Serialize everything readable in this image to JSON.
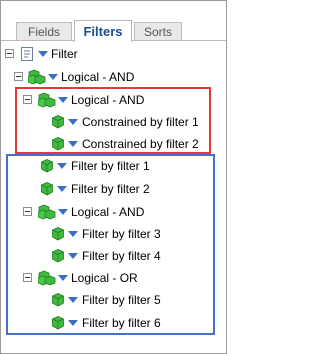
{
  "tabs": [
    {
      "label": "Fields"
    },
    {
      "label": "Filters"
    },
    {
      "label": "Sorts"
    }
  ],
  "tree": {
    "root_label": "Filter",
    "logical_and_1": "Logical - AND",
    "logical_and_2": "Logical - AND",
    "constrained_1": "Constrained by filter 1",
    "constrained_2": "Constrained by filter 2",
    "filter_1": "Filter by filter 1",
    "filter_2": "Filter by filter 2",
    "logical_and_3": "Logical - AND",
    "filter_3": "Filter by filter 3",
    "filter_4": "Filter by filter 4",
    "logical_or": "Logical - OR",
    "filter_5": "Filter by filter 5",
    "filter_6": "Filter by filter 6"
  },
  "colors": {
    "highlight_red": "#e53935",
    "highlight_blue": "#4472c4",
    "active_tab_text": "#1a4f97",
    "cube_green": "#3fb93f",
    "triangle_blue": "#3a6fc4"
  },
  "icons": {
    "expander": "collapse-box-icon",
    "root": "filter-document-icon",
    "logical": "cube-group-icon",
    "filter": "cube-icon",
    "dropdown": "triangle-down-icon"
  }
}
